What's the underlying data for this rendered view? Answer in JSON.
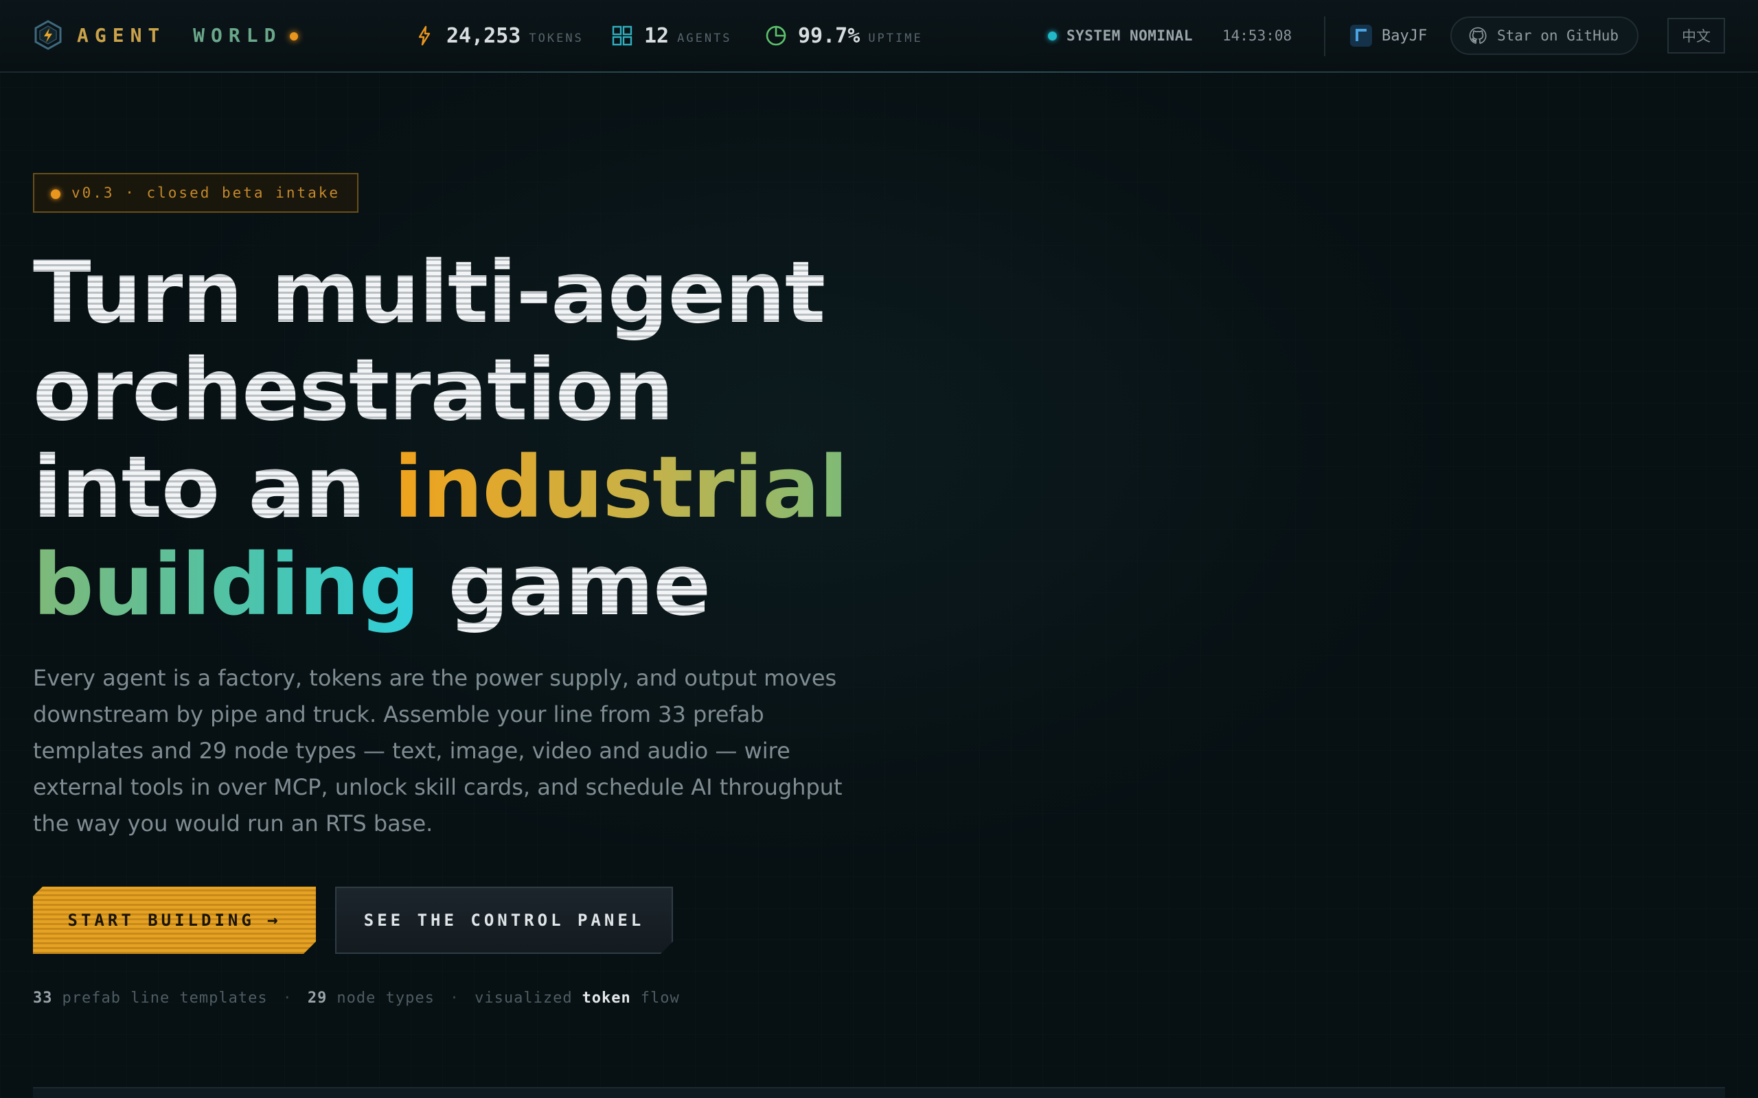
{
  "brand": {
    "name_part1": "AGENT",
    "name_part2": "WORLD"
  },
  "stats": {
    "tokens": {
      "value": "24,253",
      "label": "TOKENS",
      "icon": "lightning-icon"
    },
    "agents": {
      "value": "12",
      "label": "AGENTS",
      "icon": "grid-icon"
    },
    "uptime": {
      "value": "99.7%",
      "label": "UPTIME",
      "icon": "pie-gauge-icon"
    }
  },
  "system": {
    "status": "SYSTEM NOMINAL",
    "time": "14:53:08"
  },
  "user": {
    "name": "BayJF"
  },
  "github": {
    "label": "Star on GitHub"
  },
  "lang": {
    "label": "中文"
  },
  "hero": {
    "badge": "v0.3 · closed beta intake",
    "headline": {
      "line1": "Turn multi-agent",
      "line2": "orchestration",
      "line3_plain": "into an ",
      "line3_accent": "industrial",
      "line4_accent": "building",
      "line4_plain": " game"
    },
    "description": "Every agent is a factory, tokens are the power supply, and output moves downstream by pipe and truck. Assemble your line from 33 prefab templates and 29 node types — text, image, video and audio — wire external tools in over MCP, unlock skill cards, and schedule AI throughput the way you would run an RTS base.",
    "primary_cta": "START BUILDING",
    "primary_cta_arrow": "→",
    "secondary_cta": "SEE THE CONTROL PANEL",
    "facts": {
      "templates_count": "33",
      "templates_label": "prefab line templates",
      "separator": "·",
      "nodes_count": "29",
      "nodes_label": "node types",
      "flow_prefix": "visualized",
      "flow_token": "token",
      "flow_suffix": "flow"
    }
  },
  "colors": {
    "accent_amber": "#e8961e",
    "accent_teal": "#22b8c8",
    "accent_green": "#7dbb78",
    "background": "#071013"
  }
}
